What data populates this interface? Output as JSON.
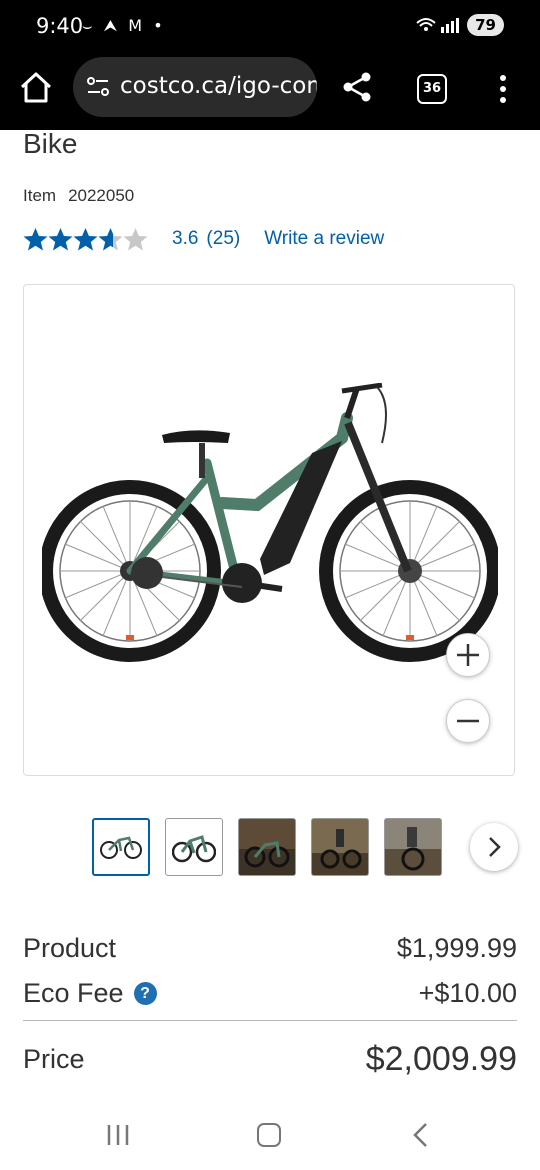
{
  "status_bar": {
    "time": "9:40",
    "notif_glyphs": "⌣ ⮝ M •",
    "battery": "79",
    "signal_icon": "wifi-signal-icon"
  },
  "browser": {
    "url": "costco.ca/igo-com",
    "tab_count": "36",
    "icons": [
      "home-icon",
      "site-settings-icon",
      "share-icon",
      "tabs-icon",
      "menu-icon"
    ]
  },
  "product": {
    "title_fragment": "Bike",
    "item_label": "Item",
    "item_number": "2022050",
    "rating": 3.6,
    "rating_value": "3.6",
    "review_count": "(25)",
    "write_review": "Write a review",
    "star_color": "#0060a9"
  },
  "gallery": {
    "thumbnail_count": 5,
    "selected_index": 0,
    "icons": [
      "zoom-in-icon",
      "zoom-out-icon",
      "chevron-right-icon"
    ]
  },
  "pricing": {
    "product_label": "Product",
    "product_price": "$1,999.99",
    "eco_fee_label": "Eco Fee",
    "eco_fee_help": "?",
    "eco_fee_value": "+$10.00",
    "price_label": "Price",
    "price_value": "$2,009.99"
  },
  "nav_bar": {
    "icons": [
      "recents-icon",
      "home-circle-icon",
      "back-icon"
    ]
  },
  "colors": {
    "link": "#0060a9",
    "help_badge": "#1f6fb2",
    "bike_frame": "#4f7d6a"
  }
}
